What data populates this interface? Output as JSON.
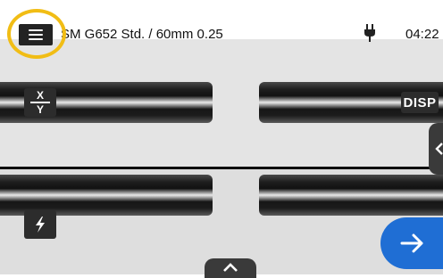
{
  "status_bar": {
    "title": "SM G652 Std. / 60mm 0.25",
    "time": "04:22",
    "menu_icon": "hamburger-menu-icon",
    "power_icon": "ac-power-plug-icon"
  },
  "overlay": {
    "xy_top": "X",
    "xy_bottom": "Y",
    "disp_label": "DISP",
    "arc_icon": "lightning-bolt-icon",
    "next_icon": "arrow-right-icon",
    "side_tab_icon": "chevron-left-icon",
    "bottom_tab_icon": "chevron-up-icon"
  },
  "colors": {
    "highlight_ring": "#f1bd15",
    "next_button": "#1f6ed4",
    "control_dark": "#2c2c2c"
  }
}
